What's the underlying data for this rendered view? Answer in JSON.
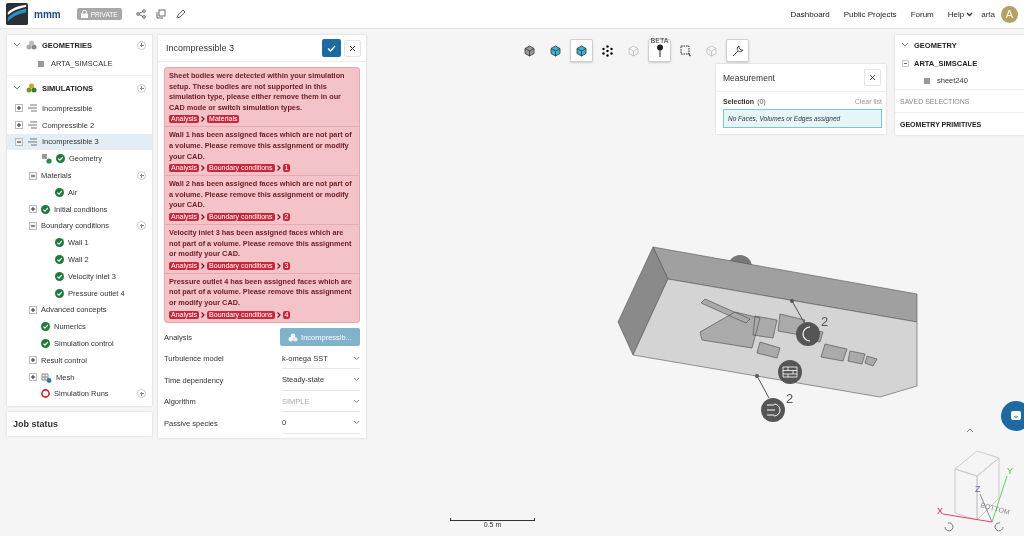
{
  "header": {
    "logo_text": "mmm",
    "badge": "PRIVATE",
    "nav": [
      "Dashboard",
      "Public Projects",
      "Forum"
    ],
    "help": "Help",
    "user": "arta",
    "avatar": "A"
  },
  "left_panel": {
    "geometries": {
      "title": "GEOMETRIES",
      "items": [
        {
          "label": "ARTA_SIMSCALE"
        }
      ]
    },
    "simulations": {
      "title": "SIMULATIONS",
      "items": [
        {
          "label": "Incompressible",
          "kind": "simulation",
          "expanded": false,
          "selected": false
        },
        {
          "label": "Compressible 2",
          "kind": "simulation",
          "expanded": false,
          "selected": false
        },
        {
          "label": "Incompressible 3",
          "kind": "simulation",
          "expanded": true,
          "selected": true,
          "children": [
            {
              "label": "Geometry",
              "kind": "geometry",
              "complete": true,
              "selected": false
            },
            {
              "label": "Materials",
              "expanded": true,
              "add": true,
              "selected": false,
              "children": [
                {
                  "label": "Air",
                  "complete": true,
                  "selected": false
                }
              ]
            },
            {
              "label": "Initial conditions",
              "expanded": false,
              "complete": true,
              "selected": false
            },
            {
              "label": "Boundary conditions",
              "expanded": true,
              "add": true,
              "selected": false,
              "children": [
                {
                  "label": "Wall 1",
                  "complete": true,
                  "selected": false
                },
                {
                  "label": "Wall 2",
                  "complete": true,
                  "selected": false
                },
                {
                  "label": "Velocity inlet 3",
                  "complete": true,
                  "selected": false
                },
                {
                  "label": "Pressure outlet 4",
                  "complete": true,
                  "selected": false
                }
              ]
            },
            {
              "label": "Advanced concepts",
              "expanded": false,
              "selected": false
            },
            {
              "label": "Numerics",
              "complete": true,
              "selected": false
            },
            {
              "label": "Simulation control",
              "complete": true,
              "selected": false
            },
            {
              "label": "Result control",
              "expanded": false,
              "selected": false
            },
            {
              "label": "Mesh",
              "kind": "mesh",
              "expanded": false,
              "selected": false
            },
            {
              "label": "Simulation Runs",
              "complete": false,
              "add": true,
              "selected": false
            }
          ]
        }
      ]
    }
  },
  "job_status": "Job status",
  "panel": {
    "title": "Incompressible 3",
    "errors": [
      {
        "message": "Sheet bodies were detected within your simulation setup. These bodies are not supported in this simulation type, please either remove them in our CAD mode or switch simulation types.",
        "path": [
          "Analysis",
          "Materials"
        ]
      },
      {
        "message": "Wall 1 has been assigned faces which are not part of a volume. Please remove this assignment or modify your CAD.",
        "path": [
          "Analysis",
          "Boundary conditions",
          "1"
        ]
      },
      {
        "message": "Wall 2 has been assigned faces which are not part of a volume. Please remove this assignment or modify your CAD.",
        "path": [
          "Analysis",
          "Boundary conditions",
          "2"
        ]
      },
      {
        "message": "Velocity inlet 3 has been assigned faces which are not part of a volume. Please remove this assignment or modify your CAD.",
        "path": [
          "Analysis",
          "Boundary conditions",
          "3"
        ]
      },
      {
        "message": "Pressure outlet 4 has been assigned faces which are not part of a volume. Please remove this assignment or modify your CAD.",
        "path": [
          "Analysis",
          "Boundary conditions",
          "4"
        ]
      }
    ],
    "properties": [
      {
        "label": "Analysis",
        "kind": "button",
        "value": "Incompressib..."
      },
      {
        "label": "Turbulence model",
        "kind": "select",
        "value": "k-omega SST",
        "disabled": false
      },
      {
        "label": "Time dependency",
        "kind": "select",
        "value": "Steady-state",
        "disabled": false
      },
      {
        "label": "Algorithm",
        "kind": "select",
        "value": "SIMPLE",
        "disabled": true
      },
      {
        "label": "Passive species",
        "kind": "select",
        "value": "0",
        "disabled": false
      }
    ]
  },
  "toolbar": [
    {
      "kind": "cube",
      "selected": false
    },
    {
      "kind": "cube-blue",
      "selected": false
    },
    {
      "kind": "cube-blue",
      "selected": true
    },
    {
      "kind": "points",
      "selected": false
    },
    {
      "kind": "cube-faint",
      "selected": false
    },
    {
      "kind": "pin",
      "selected": true,
      "badge": "BETA"
    },
    {
      "kind": "select-box",
      "selected": false
    },
    {
      "kind": "cube-faint",
      "selected": false
    },
    {
      "kind": "wrench",
      "selected": true
    }
  ],
  "measurement": {
    "title": "Measurement",
    "selection_label": "Selection",
    "count": "(0)",
    "clear": "Clear list",
    "empty": "No Faces, Volumes or Edges assigned"
  },
  "right_panel": {
    "title": "GEOMETRY",
    "root": "ARTA_SIMSCALE",
    "items": [
      "sheet240"
    ],
    "saved": "SAVED SELECTIONS",
    "primitives": "GEOMETRY PRIMITIVES"
  },
  "viewport": {
    "marker_counts": [
      "2",
      "2"
    ],
    "scale": "0.5 m",
    "axes": [
      "X",
      "Y",
      "Z"
    ],
    "cube_face": "BOTTOM"
  }
}
